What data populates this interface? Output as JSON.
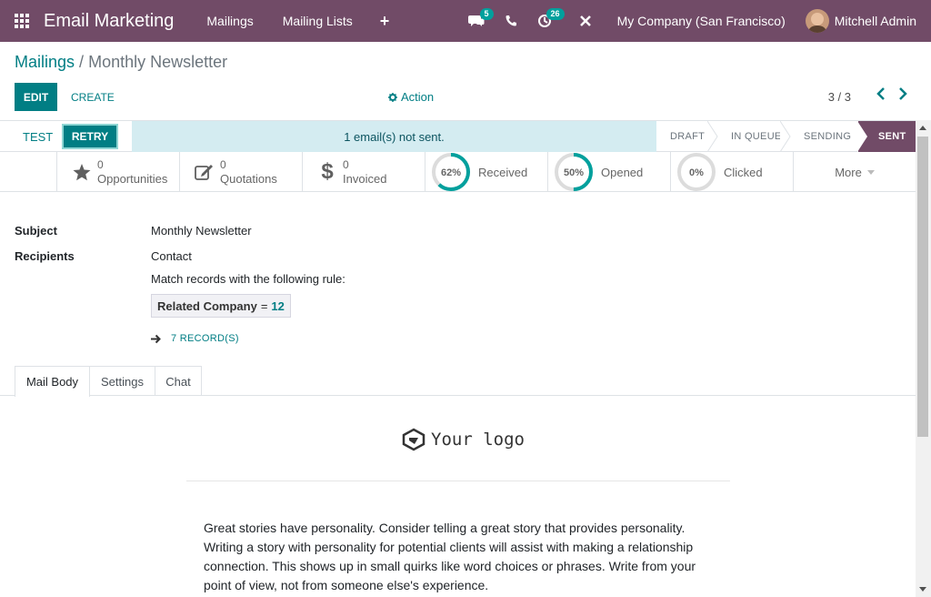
{
  "navbar": {
    "brand": "Email Marketing",
    "menus": [
      "Mailings",
      "Mailing Lists"
    ],
    "chat_badge": "5",
    "activity_badge": "26",
    "company": "My Company (San Francisco)",
    "user": "Mitchell Admin",
    "color": "#714b67"
  },
  "breadcrumb": {
    "parent": "Mailings",
    "separator": "/",
    "current": "Monthly Newsletter"
  },
  "toolbar": {
    "edit_label": "EDIT",
    "create_label": "CREATE",
    "action_label": "Action",
    "pager": "3 / 3"
  },
  "statusbar": {
    "test_label": "TEST",
    "retry_label": "RETRY",
    "alert_text": "1  email(s) not sent.",
    "stages": [
      "DRAFT",
      "IN QUEUE",
      "SENDING",
      "SENT"
    ],
    "active_stage": "SENT"
  },
  "stats": {
    "opportunities": {
      "count": "0",
      "label": "Opportunities"
    },
    "quotations": {
      "count": "0",
      "label": "Quotations"
    },
    "invoiced": {
      "count": "0",
      "label": "Invoiced"
    },
    "received": {
      "percent": 62,
      "text": "62%",
      "label": "Received"
    },
    "opened": {
      "percent": 50,
      "text": "50%",
      "label": "Opened"
    },
    "clicked": {
      "percent": 0,
      "text": "0%",
      "label": "Clicked"
    },
    "more_label": "More"
  },
  "form": {
    "subject_label": "Subject",
    "subject_value": "Monthly Newsletter",
    "recipients_label": "Recipients",
    "recipients_value": "Contact",
    "rule_intro": "Match records with the following rule:",
    "rule_field": "Related Company",
    "rule_operator": "=",
    "rule_value": "12",
    "records_label": "7 RECORD(S)"
  },
  "tabs": [
    "Mail Body",
    "Settings",
    "Chat"
  ],
  "mail_body": {
    "logo_text": "Your logo",
    "paragraph": "Great stories have personality. Consider telling a great story that provides personality. Writing a story with personality for potential clients will assist with making a relationship connection. This shows up in small quirks like word choices or phrases. Write from your point of view, not from someone else's experience."
  }
}
